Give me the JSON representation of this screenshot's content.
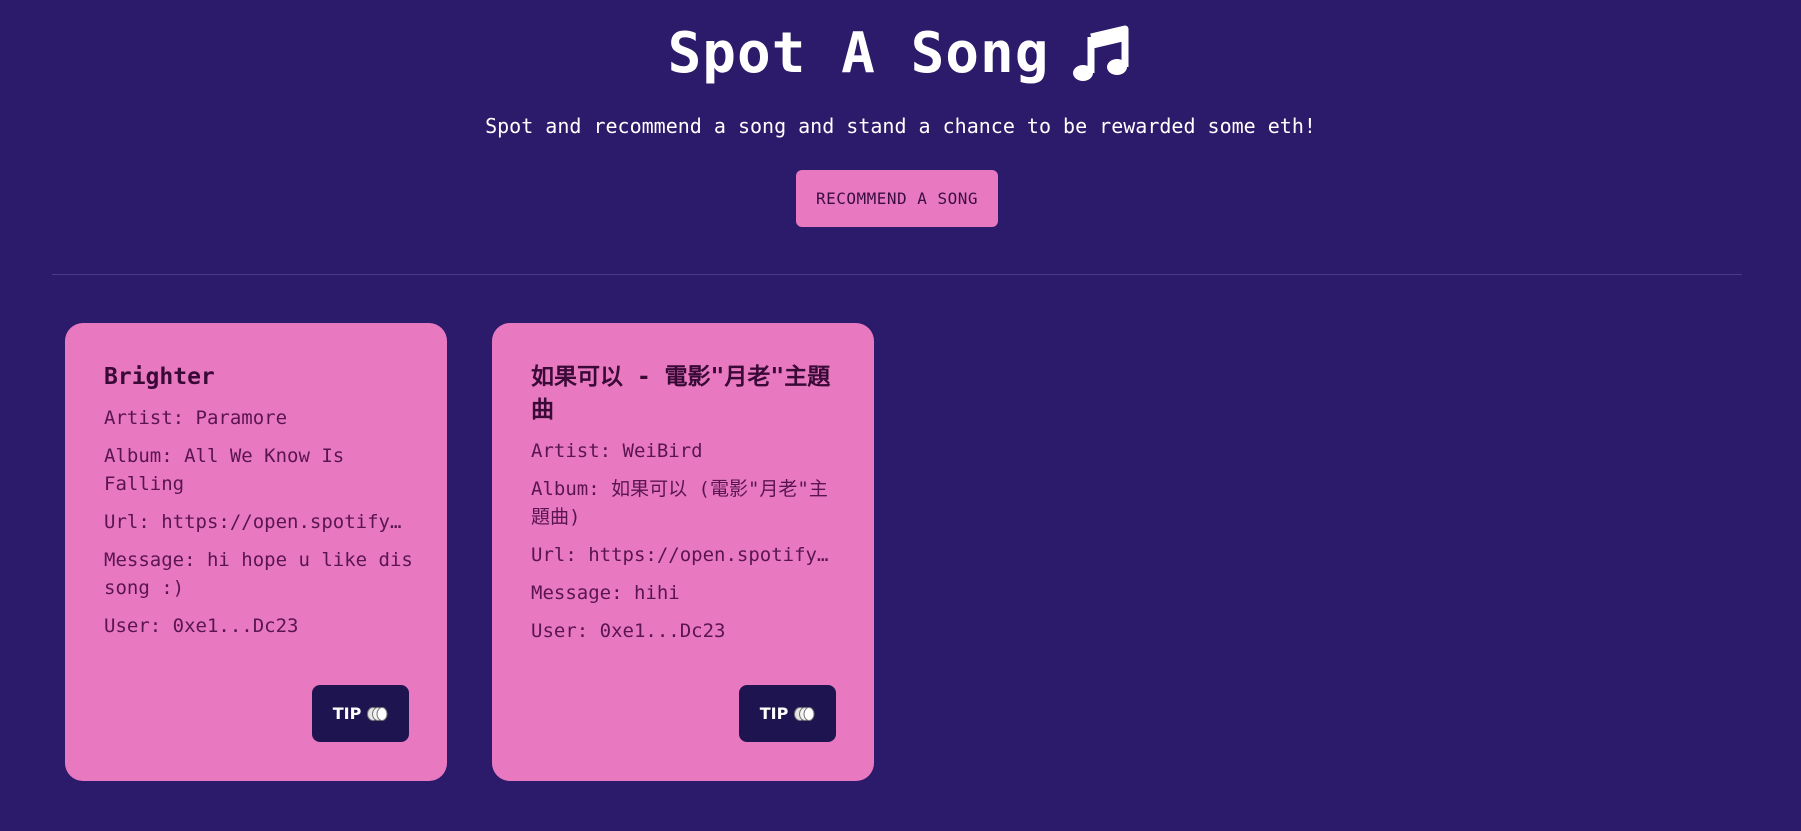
{
  "header": {
    "title": "Spot A Song",
    "title_icon": "music-note-icon",
    "subtitle": "Spot and recommend a song and stand a chance to be rewarded some eth!",
    "recommend_button": "RECOMMEND A SONG"
  },
  "colors": {
    "background": "#2c1a6b",
    "card": "#e879c1",
    "button_dark": "#1e1450",
    "accent_pink": "#e879c1"
  },
  "songs": [
    {
      "title": "Brighter",
      "artist": "Artist: Paramore",
      "album": "Album: All We Know Is Falling",
      "url": "Url: https://open.spotify.com",
      "message": "Message: hi hope u like dis song :)",
      "user": "User: 0xe1...Dc23",
      "tip_label": "TIP",
      "tip_icon": "coins-icon"
    },
    {
      "title": "如果可以 - 電影\"月老\"主題曲",
      "artist": "Artist: WeiBird",
      "album": "Album: 如果可以 (電影\"月老\"主題曲)",
      "url": "Url: https://open.spotify.com",
      "message": "Message: hihi",
      "user": "User: 0xe1...Dc23",
      "tip_label": "TIP",
      "tip_icon": "coins-icon"
    }
  ]
}
